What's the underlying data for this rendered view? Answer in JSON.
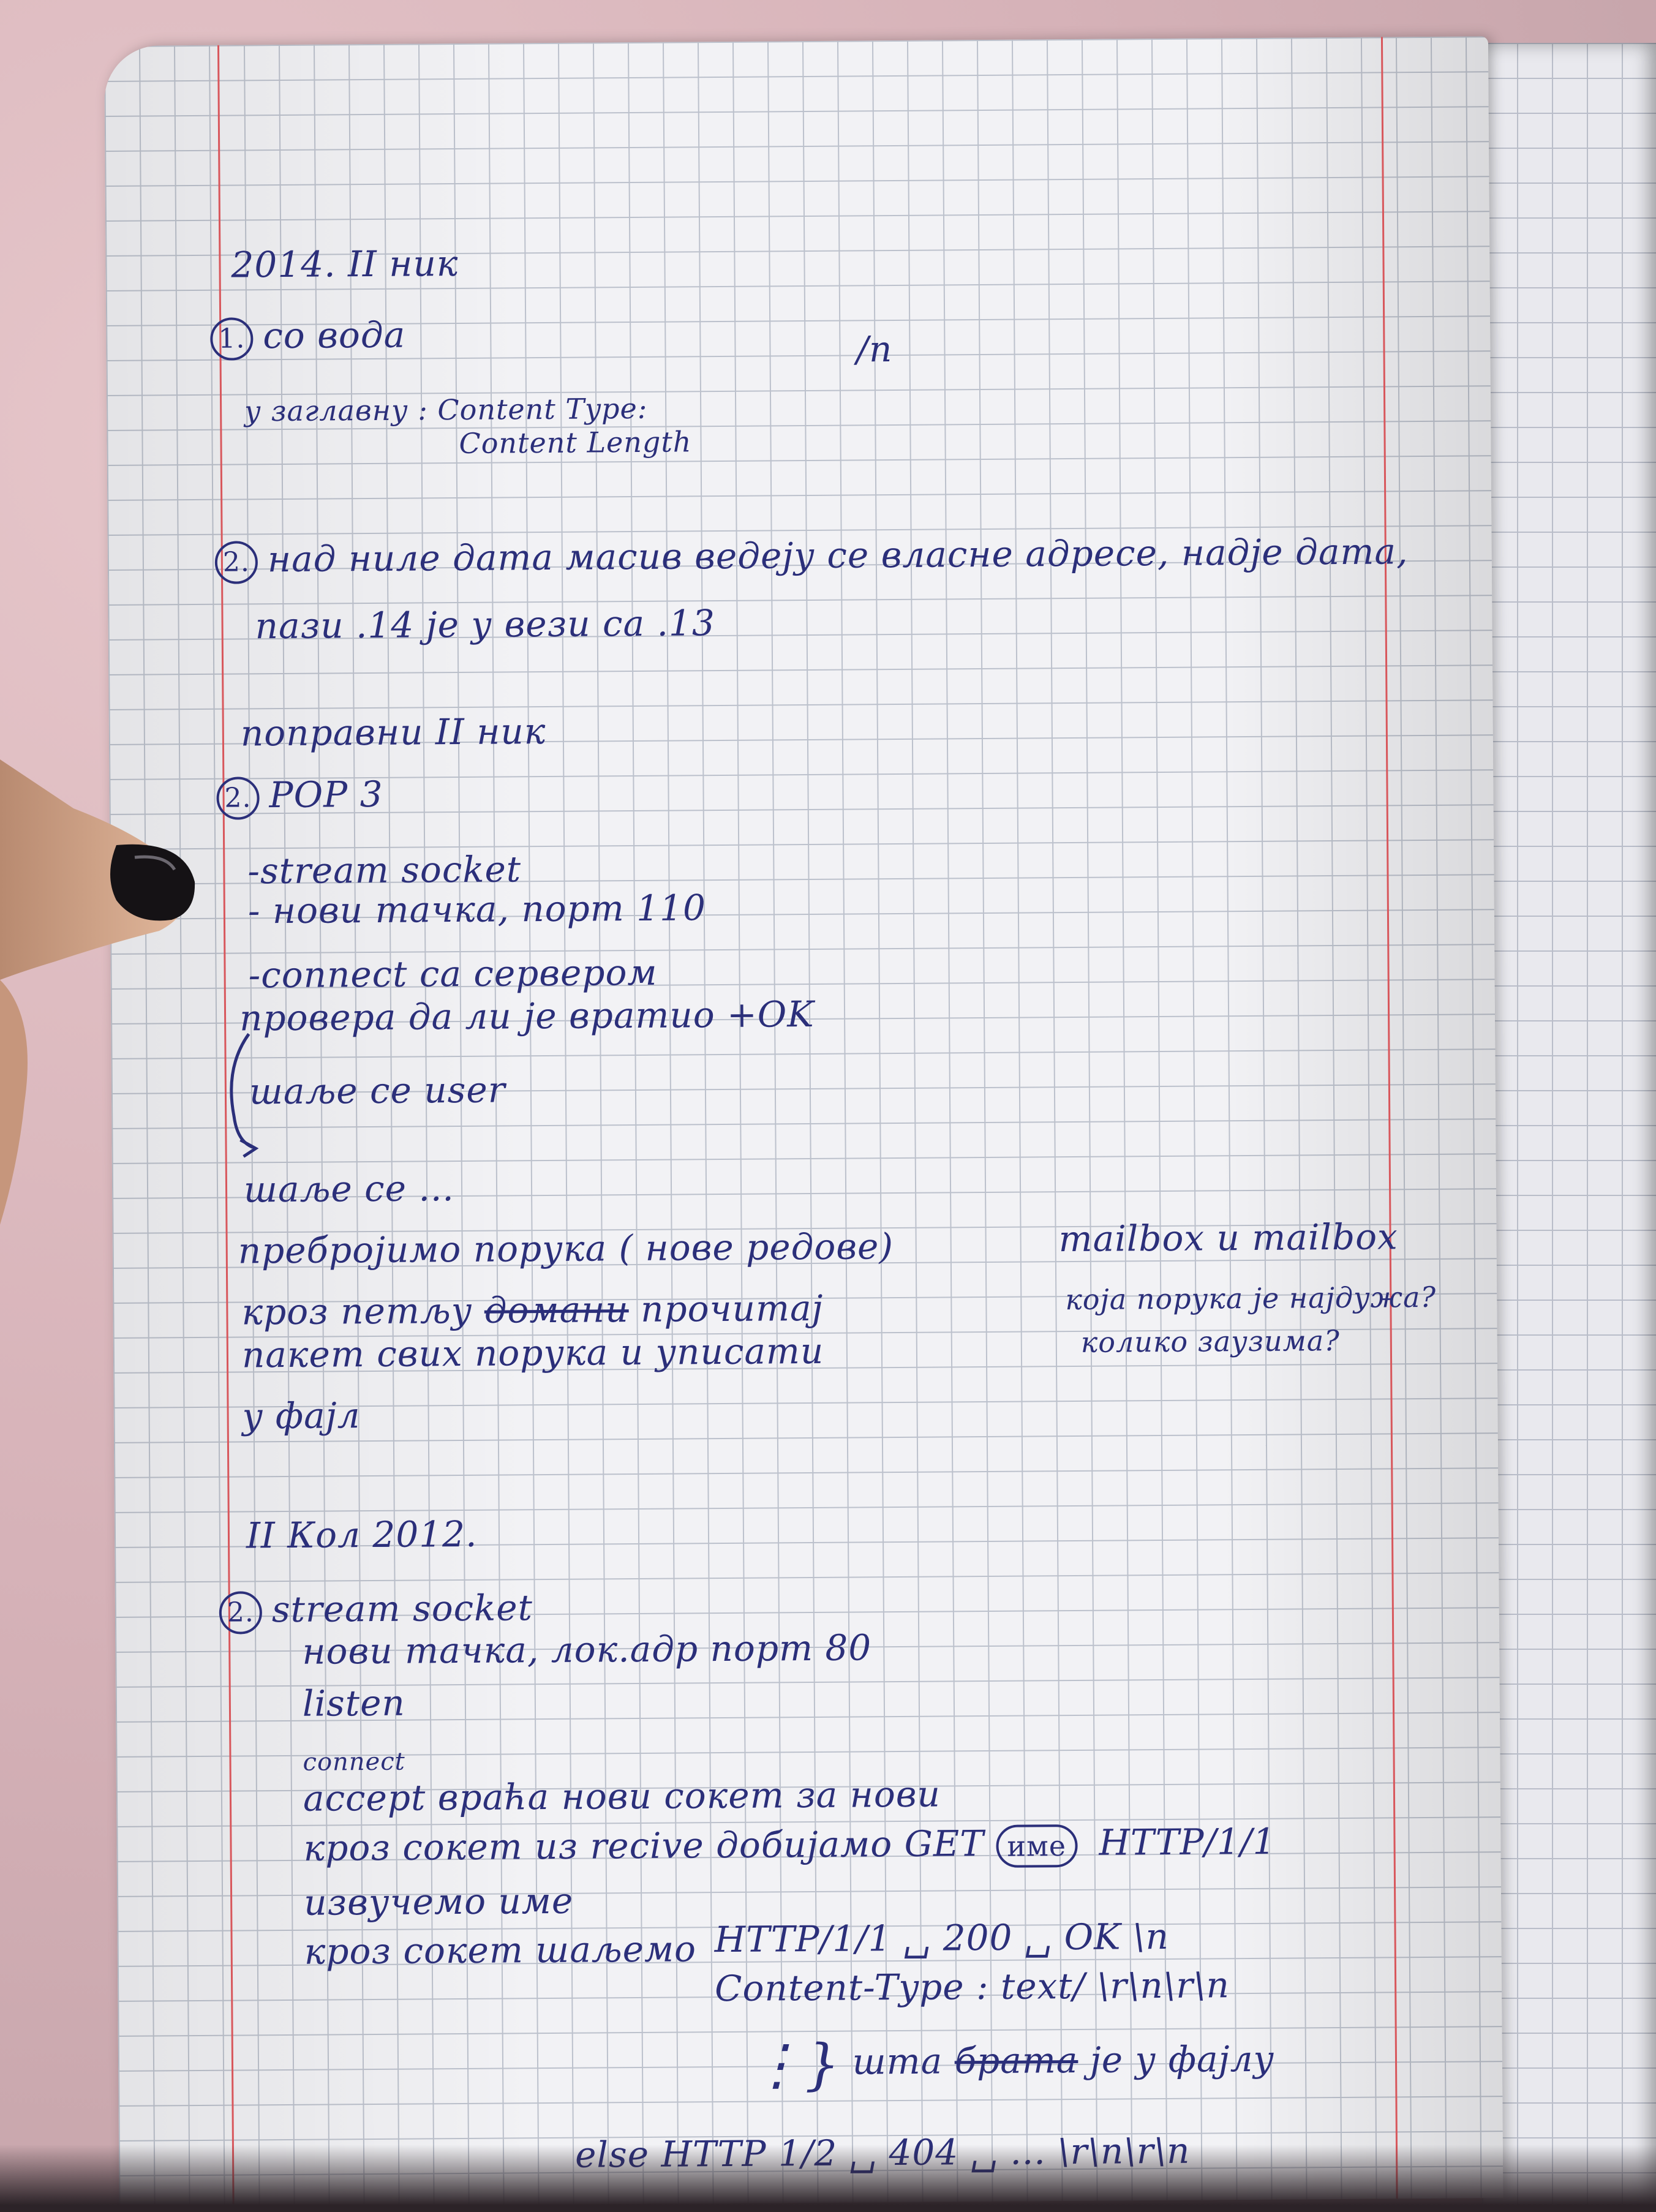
{
  "notes": {
    "l01": "2014. II ник",
    "q1_num": "1.",
    "l02": "со вода",
    "l03": "у заглавну : Content Type:",
    "l04": "Content Length",
    "l05": "/n",
    "q2_num": "2.",
    "l06": "над ниле дата масив ведеју се власне адресе, надје дата,",
    "l07": "пази .14 је у вези са .13",
    "l08": "поправни II ник",
    "q3_num": "2.",
    "l09": "POP 3",
    "l10": "-stream socket",
    "l11": "- нови тачка, порт 110",
    "l12": "-connect са сервером",
    "l13": "провера да ли је вратио +OK",
    "l14": "шаље се user",
    "l15": "шаље се ...",
    "l16": "пребројимо порука ( нове редове)",
    "l17": "mailbox и mailbox",
    "l18a": "кроз петљу",
    "l18b": "домани",
    "l18c": "прочитај",
    "l19": "пакет свих порука и уписати",
    "l20": "у фајл",
    "l21": "која порука је најдужа?",
    "l22": "колико заузима?",
    "l23": "II Кол 2012.",
    "q4_num": "2.",
    "l24": "stream socket",
    "l25": "нови тачка, лок.адр порт 80",
    "l26": "listen",
    "l27": "connect",
    "l28": "accept враћа нови сокет за нови",
    "l29a": "кроз сокет из recive добијамо GET",
    "l29b": "име",
    "l29c": "HTTP/1/1",
    "l30": "извучемо име",
    "l31": "кроз сокет шаљемо",
    "l32": "HTTP/1/1 ␣ 200 ␣ OK \\n",
    "l33": "Content-Type : text/ \\r\\n\\r\\n",
    "l34a": "шта",
    "l34b": "брата",
    "l34c": "је у фајлу",
    "l35": "else HTTP 1/2 ␣ 404 ␣ ... \\r\\n\\r\\n"
  }
}
